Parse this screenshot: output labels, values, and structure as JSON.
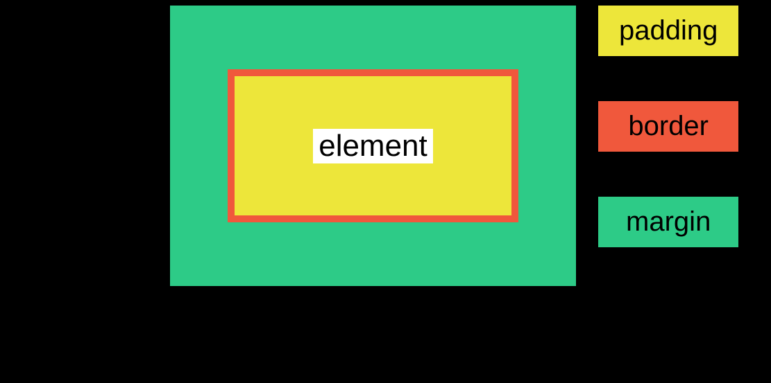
{
  "diagram": {
    "center_label": "element",
    "layers": [
      {
        "name": "margin",
        "color": "#2DCB87"
      },
      {
        "name": "border",
        "color": "#F0583C"
      },
      {
        "name": "padding",
        "color": "#EDE63A"
      },
      {
        "name": "element",
        "color": "#FFFFFF"
      }
    ]
  },
  "legend": {
    "padding": "padding",
    "border": "border",
    "margin": "margin"
  }
}
